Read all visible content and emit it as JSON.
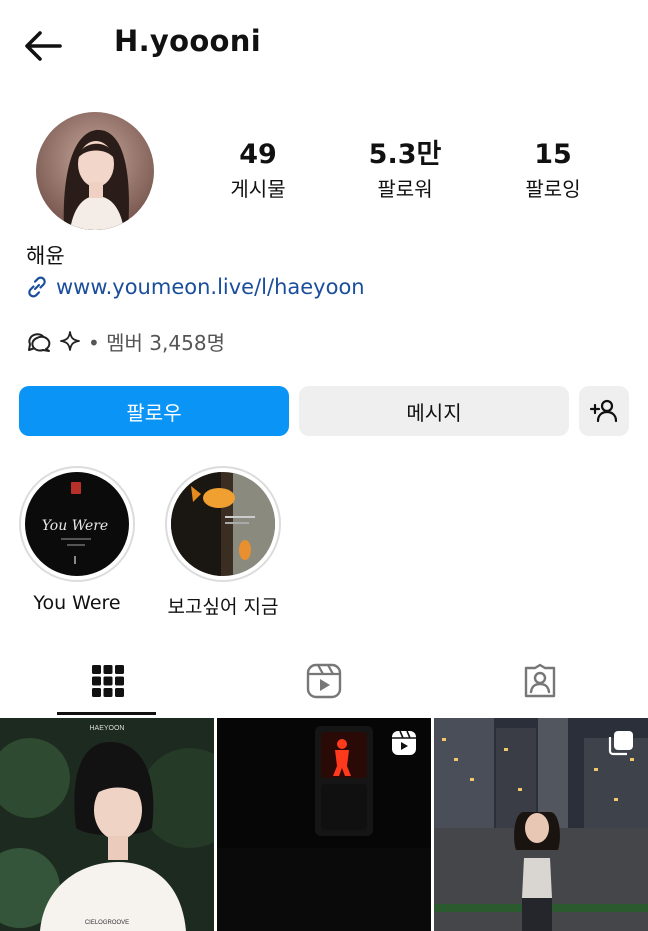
{
  "header": {
    "username": "H.yoooni",
    "back_icon": "arrow-left-icon"
  },
  "profile": {
    "display_name": "해윤",
    "link": "www.youmeon.live/l/haeyoon",
    "channel_text": "• 멤버 3,458명"
  },
  "stats": [
    {
      "value": "49",
      "label": "게시물"
    },
    {
      "value": "5.3만",
      "label": "팔로워"
    },
    {
      "value": "15",
      "label": "팔로잉"
    }
  ],
  "buttons": {
    "follow": "팔로우",
    "message": "메시지",
    "add_user_icon": "add-user-icon"
  },
  "highlights": [
    {
      "label": "You Were",
      "cover_text": "You Were"
    },
    {
      "label": "보고싶어 지금"
    }
  ],
  "tabs": [
    {
      "icon": "grid-icon",
      "active": true
    },
    {
      "icon": "reels-icon",
      "active": false
    },
    {
      "icon": "tagged-icon",
      "active": false
    }
  ],
  "posts": [
    {
      "caption_top": "HAEYOON",
      "caption_bottom": "CIELOGROOVE"
    },
    {
      "badge": "reel-icon"
    },
    {
      "badge": "multi-post-icon"
    }
  ],
  "colors": {
    "primary": "#0a95f6",
    "link": "#1a4e9c",
    "secondary_bg": "#efefef"
  }
}
